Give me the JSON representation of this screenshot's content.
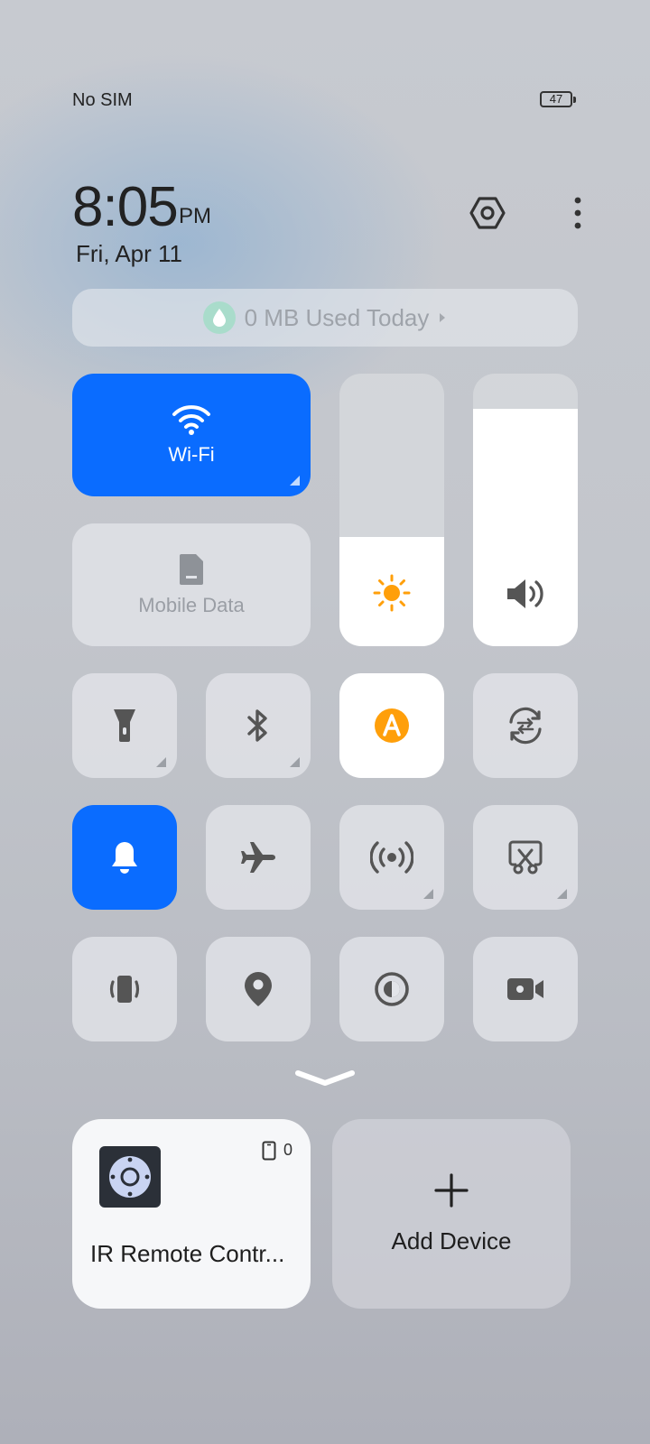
{
  "status_bar": {
    "carrier": "No SIM",
    "battery_level": "47"
  },
  "header": {
    "time": "8:05",
    "ampm": "PM",
    "date": "Fri, Apr 11",
    "settings_icon": "hexagon-settings-icon",
    "more_icon": "vertical-dots-icon"
  },
  "data_usage": {
    "label": "0 MB Used Today",
    "icon": "water-drop-icon"
  },
  "tiles": {
    "wifi": {
      "label": "Wi-Fi",
      "active": true
    },
    "mobile_data": {
      "label": "Mobile Data",
      "active": false
    }
  },
  "sliders": {
    "brightness_level": 0.4,
    "volume_level": 0.87
  },
  "quick_toggles": [
    {
      "name": "flashlight",
      "icon": "flashlight-icon",
      "state": "off"
    },
    {
      "name": "bluetooth",
      "icon": "bluetooth-icon",
      "state": "off"
    },
    {
      "name": "auto-brightness",
      "icon": "auto-a-icon",
      "state": "on"
    },
    {
      "name": "auto-rotate",
      "icon": "rotate-icon",
      "state": "off"
    },
    {
      "name": "ring",
      "icon": "bell-icon",
      "state": "on"
    },
    {
      "name": "airplane-mode",
      "icon": "airplane-icon",
      "state": "off"
    },
    {
      "name": "hotspot",
      "icon": "hotspot-icon",
      "state": "off"
    },
    {
      "name": "screenshot",
      "icon": "scissors-icon",
      "state": "off"
    },
    {
      "name": "vibrate",
      "icon": "vibrate-icon",
      "state": "off"
    },
    {
      "name": "location",
      "icon": "location-pin-icon",
      "state": "off"
    },
    {
      "name": "dark-mode",
      "icon": "contrast-icon",
      "state": "off"
    },
    {
      "name": "screen-record",
      "icon": "video-camera-icon",
      "state": "off"
    }
  ],
  "colors": {
    "accent_blue": "#0a6cff",
    "warning_orange": "#ff9f0a"
  },
  "devices": {
    "ir_remote": {
      "label": "IR Remote Contr...",
      "count": "0",
      "icon": "ir-remote-icon"
    },
    "add_device": {
      "label": "Add Device",
      "icon": "plus-icon"
    }
  }
}
